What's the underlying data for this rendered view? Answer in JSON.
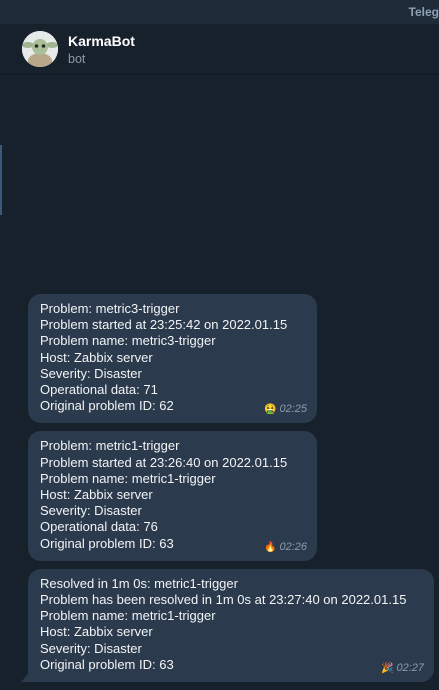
{
  "window": {
    "app_title": "Teleg"
  },
  "chat": {
    "name": "KarmaBot",
    "status": "bot",
    "avatar_icon": "baby-yoda-avatar"
  },
  "messages": [
    {
      "lines": [
        "Problem: metric3-trigger",
        "Problem started at 23:25:42 on 2022.01.15",
        "Problem name: metric3-trigger",
        "Host: Zabbix server",
        "Severity: Disaster",
        "Operational data: 71",
        "Original problem ID: 62"
      ],
      "emoji": "🤮",
      "time": "02:25"
    },
    {
      "lines": [
        "Problem: metric1-trigger",
        "Problem started at 23:26:40 on 2022.01.15",
        "Problem name: metric1-trigger",
        "Host: Zabbix server",
        "Severity: Disaster",
        "Operational data: 76",
        "Original problem ID: 63"
      ],
      "emoji": "🔥",
      "time": "02:26"
    },
    {
      "lines": [
        "Resolved in 1m 0s: metric1-trigger",
        "Problem has been resolved in 1m 0s at 23:27:40 on 2022.01.15",
        "Problem name: metric1-trigger",
        "Host: Zabbix server",
        "Severity: Disaster",
        "Original problem ID: 63"
      ],
      "emoji": "🎉",
      "time": "02:27"
    }
  ]
}
